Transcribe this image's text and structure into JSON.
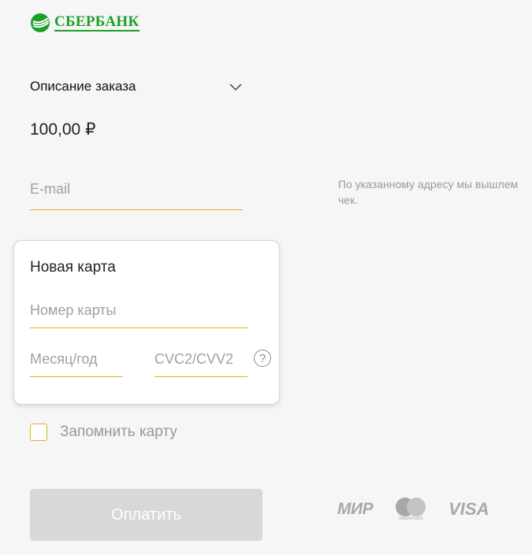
{
  "brand": {
    "name": "СБЕРБАНК",
    "color": "#1a9f29"
  },
  "order": {
    "description_label": "Описание заказа",
    "amount": "100,00 ₽"
  },
  "email": {
    "placeholder": "E-mail",
    "value": "",
    "hint": "По указанному адресу мы вышлем чек."
  },
  "card": {
    "title": "Новая карта",
    "number_placeholder": "Номер карты",
    "expiry_placeholder": "Месяц/год",
    "cvc_placeholder": "CVC2/CVV2",
    "help_symbol": "?"
  },
  "remember": {
    "label": "Запомнить карту",
    "checked": false
  },
  "pay_button": {
    "label": "Оплатить",
    "enabled": false
  },
  "payment_systems": {
    "mir": "МИР",
    "mastercard": "mastercard",
    "visa": "VISA"
  },
  "colors": {
    "accent": "#e3b11a",
    "background": "#f6f6f6",
    "button_disabled": "#d8d8d8"
  },
  "icons": [
    "sberbank-logo-icon",
    "chevron-down-icon",
    "help-icon",
    "checkbox-icon",
    "mir-logo-icon",
    "mastercard-logo-icon",
    "visa-logo-icon"
  ]
}
